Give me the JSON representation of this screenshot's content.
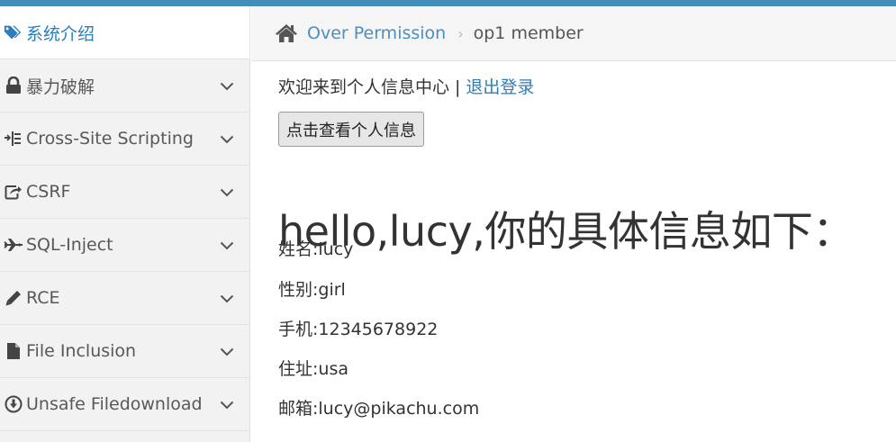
{
  "sidebar": {
    "items": [
      {
        "label": "系统介绍",
        "icon": "tags-icon",
        "active": true,
        "expandable": false
      },
      {
        "label": "暴力破解",
        "icon": "lock-icon",
        "active": false,
        "expandable": true
      },
      {
        "label": "Cross-Site Scripting",
        "icon": "indent-list-icon",
        "active": false,
        "expandable": true
      },
      {
        "label": "CSRF",
        "icon": "share-icon",
        "active": false,
        "expandable": true
      },
      {
        "label": "SQL-Inject",
        "icon": "plane-icon",
        "active": false,
        "expandable": true
      },
      {
        "label": "RCE",
        "icon": "pencil-icon",
        "active": false,
        "expandable": true
      },
      {
        "label": "File Inclusion",
        "icon": "file-icon",
        "active": false,
        "expandable": true
      },
      {
        "label": "Unsafe Filedownload",
        "icon": "download-circle-icon",
        "active": false,
        "expandable": true
      }
    ]
  },
  "breadcrumb": {
    "home_icon": "home-icon",
    "link": "Over Permission",
    "separator": "›",
    "current": "op1 member"
  },
  "main": {
    "welcome_text": "欢迎来到个人信息中心",
    "welcome_sep": "|",
    "logout_link": "退出登录",
    "view_button": "点击查看个人信息",
    "title": "hello,lucy,你的具体信息如下：",
    "fields": [
      "姓名:lucy",
      "性别:girl",
      "手机:12345678922",
      "住址:usa",
      "邮箱:lucy@pikachu.com"
    ]
  },
  "colors": {
    "accent": "#438eb9",
    "link": "#2b7dbc",
    "sidebar_bg": "#f2f2f2",
    "breadcrumb_bg": "#f5f5f5"
  }
}
